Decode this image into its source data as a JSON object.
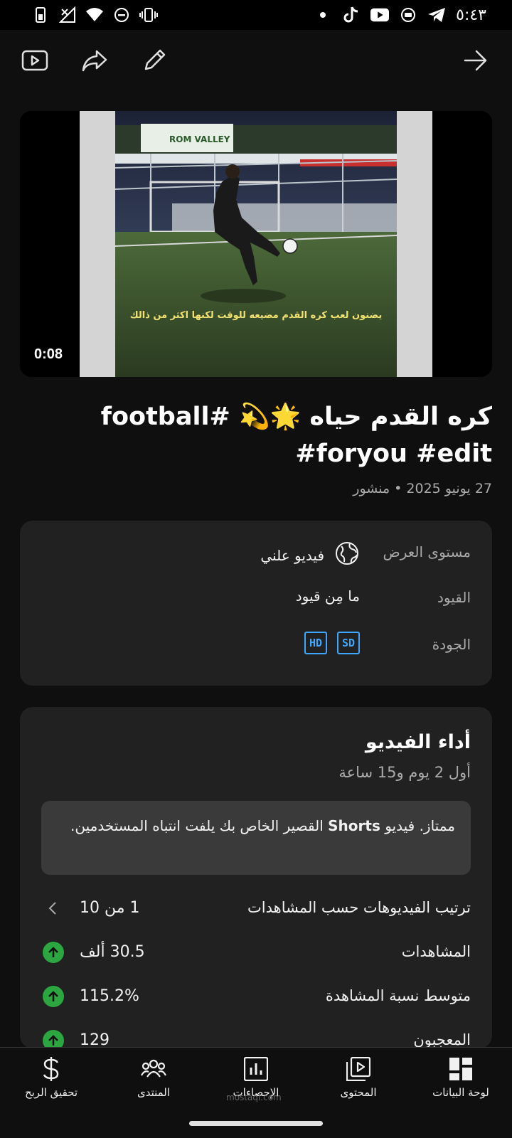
{
  "status_bar": {
    "time": "٥:٤٣",
    "icons_left": [
      "sim-icon",
      "no-signal-icon",
      "wifi-icon",
      "dnd-icon",
      "vibrate-icon"
    ],
    "icons_right": [
      "dot-icon",
      "tiktok-icon",
      "youtube-icon",
      "media-icon",
      "telegram-icon"
    ]
  },
  "toolbar": {
    "icons": [
      "open-in-app-icon",
      "share-icon",
      "edit-icon",
      "back-arrow-icon"
    ]
  },
  "video": {
    "duration": "0:08",
    "caption": "يضنون لعب كره القدم مضيعه للوقت لكنها اكثر من ذالك",
    "sign_text": "ROM VALLEY"
  },
  "title": "كره القدم حياه 🌟💫 #football #foryou #edit",
  "published": "27 يونيو 2025 • منشور",
  "details": {
    "visibility_label": "مستوى العرض",
    "visibility_value": "فيديو علني",
    "restrictions_label": "القيود",
    "restrictions_value": "ما مِن قيود",
    "quality_label": "الجودة",
    "quality_badges": [
      "HD",
      "SD"
    ]
  },
  "performance": {
    "title": "أداء الفيديو",
    "subtitle": "أول 2 يوم و15 ساعة",
    "notice_prefix": "ممتاز. فيديو ",
    "notice_bold": "Shorts",
    "notice_suffix": " القصير الخاص بك يلفت انتباه المستخدمين.",
    "metrics": [
      {
        "label": "ترتيب الفيديوهات حسب المشاهدات",
        "value": "1 من 10",
        "icon": "chevron-left-icon"
      },
      {
        "label": "المشاهدات",
        "value": "30.5 ألف",
        "icon": "arrow-up-icon"
      },
      {
        "label": "متوسط نسبة المشاهدة",
        "value": "115.2%",
        "icon": "arrow-up-icon"
      },
      {
        "label": "المعجبون",
        "value": "129",
        "icon": "arrow-up-icon"
      }
    ]
  },
  "bottom_nav": [
    {
      "label": "لوحة البيانات",
      "icon": "dashboard-icon"
    },
    {
      "label": "المحتوى",
      "icon": "content-icon"
    },
    {
      "label": "الإحصاءات",
      "icon": "analytics-icon"
    },
    {
      "label": "المنتدى",
      "icon": "community-icon"
    },
    {
      "label": "تحقيق الربح",
      "icon": "dollar-icon"
    }
  ],
  "watermark": "mostaql.com"
}
